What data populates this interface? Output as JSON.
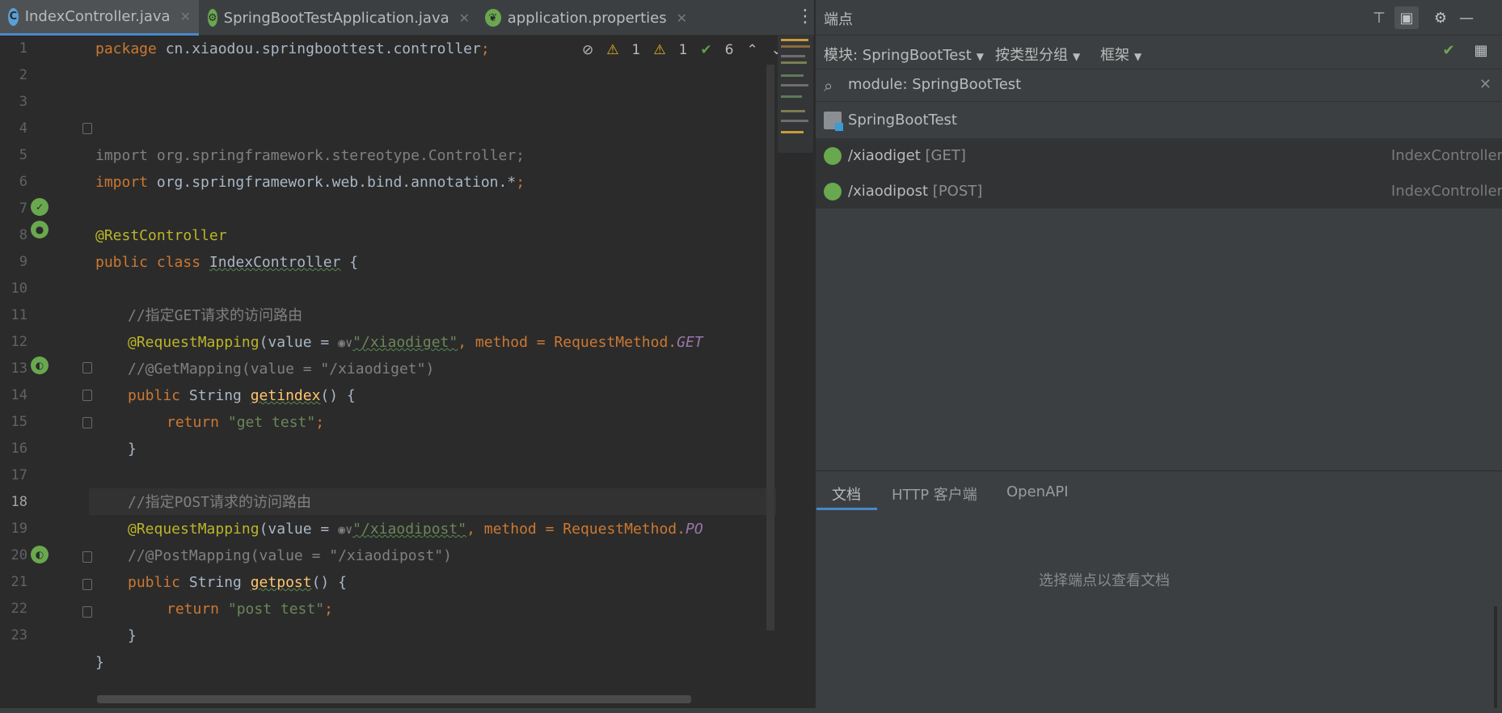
{
  "editor": {
    "tabs": [
      {
        "label": "IndexController.java",
        "icon": "class-c-icon"
      },
      {
        "label": "SpringBootTestApplication.java",
        "icon": "spring-boot-icon"
      },
      {
        "label": "application.properties",
        "icon": "spring-properties-icon"
      }
    ],
    "status": {
      "warn_a": "1",
      "warn_b": "1",
      "ok": "6"
    },
    "line_numbers": [
      "1",
      "2",
      "3",
      "4",
      "5",
      "6",
      "7",
      "8",
      "9",
      "10",
      "11",
      "12",
      "13",
      "14",
      "15",
      "16",
      "17",
      "18",
      "19",
      "20",
      "21",
      "22",
      "23"
    ],
    "code": {
      "l1_kw": "package",
      "l1_rest": " cn.xiaodou.springboottest.controller",
      "l1_semi": ";",
      "l4_kw": "import",
      "l4_rest": " org.springframework.stereotype.Controller;",
      "l5_kw": "import",
      "l5_rest": " org.springframework.web.bind.annotation.*",
      "l5_semi": ";",
      "l7": "@RestController",
      "l8_kw": "public class ",
      "l8_name": "IndexController",
      "l8_rest": " {",
      "l10": "//指定GET请求的访问路由",
      "l11_ann": "@RequestMapping",
      "l11_a": "(value = ",
      "l11_inlay": "◉∨",
      "l11_str": "\"/xiaodiget\"",
      "l11_b": ", method = RequestMethod.",
      "l11_enum": "GET",
      "l12": "//@GetMapping(value = \"/xiaodiget\")",
      "l13_kw": "public ",
      "l13_type": "String ",
      "l13_fn": "getindex",
      "l13_rest": "() {",
      "l14_kw": "return ",
      "l14_str": "\"get test\"",
      "l14_semi": ";",
      "l15": "}",
      "l17": "//指定POST请求的访问路由",
      "l18_ann": "@RequestMapping",
      "l18_a": "(value = ",
      "l18_inlay": "◉∨",
      "l18_str": "\"/xiaodipost\"",
      "l18_b": ", method = RequestMethod.",
      "l18_enum": "PO",
      "l19": "//@PostMapping(value = \"/xiaodipost\")",
      "l20_kw": "public ",
      "l20_type": "String ",
      "l20_fn": "getpost",
      "l20_rest": "() {",
      "l21_kw": "return ",
      "l21_str": "\"post test\"",
      "l21_semi": ";",
      "l22": "}",
      "l23": "}"
    }
  },
  "panel": {
    "title": "端点",
    "filters": {
      "module": "模块: SpringBootTest",
      "group": "按类型分组",
      "framework": "框架"
    },
    "search": {
      "value": "module: SpringBootTest"
    },
    "rows": [
      {
        "label": "SpringBootTest",
        "method": "",
        "owner": ""
      },
      {
        "label": "/xiaodiget",
        "method": "[GET]",
        "owner": "IndexController"
      },
      {
        "label": "/xiaodipost",
        "method": "[POST]",
        "owner": "IndexController"
      }
    ],
    "doc_tabs": [
      "文档",
      "HTTP 客户端",
      "OpenAPI"
    ],
    "doc_message": "选择端点以查看文档"
  },
  "colors": {
    "editor_bg": "#2b2b2b",
    "panel_bg": "#3c3f41",
    "keyword": "#cc7832",
    "string": "#6a8759",
    "annotation": "#bbb529",
    "accent": "#4a88c7",
    "spring_green": "#6aa84f"
  }
}
